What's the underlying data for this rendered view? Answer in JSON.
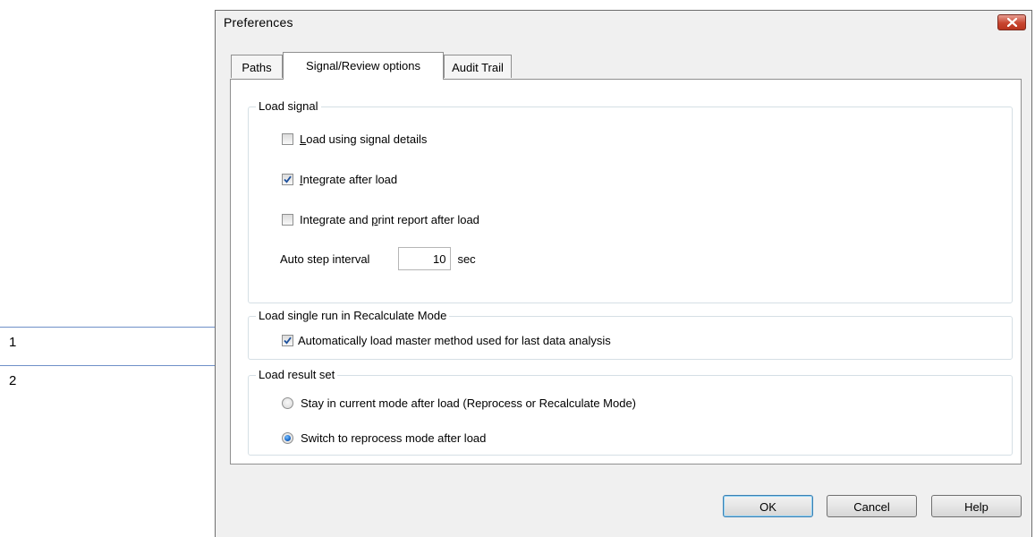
{
  "callouts": [
    {
      "number": "1"
    },
    {
      "number": "2"
    }
  ],
  "window": {
    "title": "Preferences"
  },
  "tabs": [
    {
      "label": "Paths",
      "active": false
    },
    {
      "label": "Signal/Review options",
      "active": true
    },
    {
      "label": "Audit Trail",
      "active": false
    }
  ],
  "load_signal": {
    "legend": "Load signal",
    "load_using_details": {
      "label_prefix": "",
      "label_mnemonic": "L",
      "label_rest": "oad using signal details",
      "checked": false
    },
    "integrate_after_load": {
      "label_prefix": "",
      "label_mnemonic": "I",
      "label_rest": "ntegrate after load",
      "checked": true
    },
    "integrate_print": {
      "label_prefix": "Integrate and ",
      "label_mnemonic": "p",
      "label_rest": "rint report after load",
      "checked": false
    },
    "auto_step": {
      "label": "Auto step interval",
      "value": "10",
      "unit": "sec"
    }
  },
  "load_single_run": {
    "legend": "Load single run in Recalculate Mode",
    "auto_load_master": {
      "label": "Automatically load master method used for last data analysis",
      "checked": true
    }
  },
  "load_result_set": {
    "legend": "Load result set",
    "options": [
      {
        "label": "Stay in current mode after load (Reprocess or Recalculate Mode)",
        "selected": false
      },
      {
        "label": "Switch to reprocess mode after load",
        "selected": true
      }
    ]
  },
  "buttons": {
    "ok": "OK",
    "cancel": "Cancel",
    "help": "Help"
  },
  "colors": {
    "callout_line": "#6f90c8",
    "close_button": "#c8452f",
    "check_mark": "#1b4f9c",
    "radio_selected": "#1767c8"
  },
  "icons": {
    "close": "close-icon",
    "check": "checkmark-icon"
  }
}
